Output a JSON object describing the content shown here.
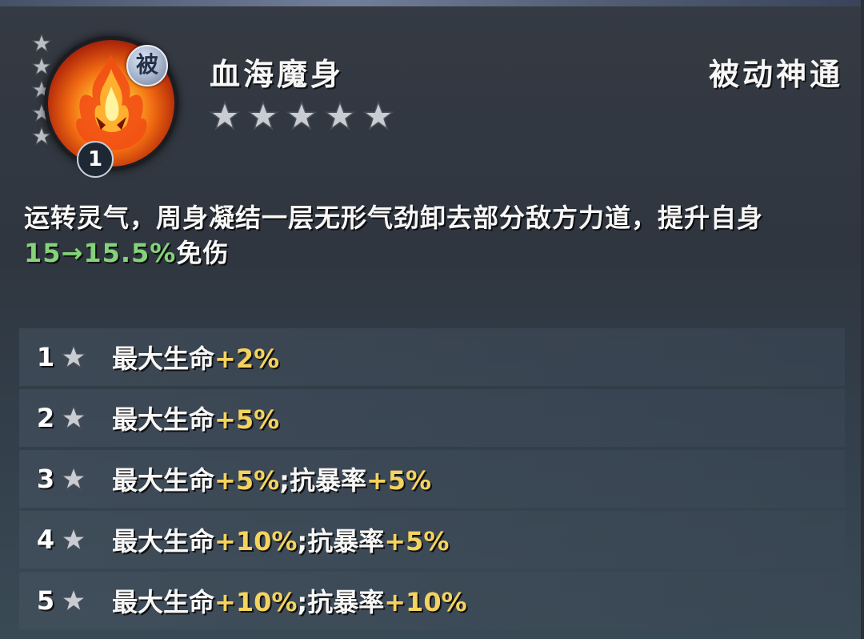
{
  "skill": {
    "name": "血海魔身",
    "type": "被动神通",
    "badge": "被",
    "level": "1",
    "rating_stars": 5,
    "description_prefix": "运转灵气，周身凝结一层无形气劲卸去部分敌方力道，提升自身",
    "description_value": "15→15.5%",
    "description_suffix": "免伤"
  },
  "levels": [
    {
      "num": "1",
      "parts": [
        {
          "text": "最大生命",
          "value": "+2%"
        }
      ]
    },
    {
      "num": "2",
      "parts": [
        {
          "text": "最大生命",
          "value": "+5%"
        }
      ]
    },
    {
      "num": "3",
      "parts": [
        {
          "text": "最大生命",
          "value": "+5%"
        },
        {
          "text": ";抗暴率",
          "value": "+5%"
        }
      ]
    },
    {
      "num": "4",
      "parts": [
        {
          "text": "最大生命",
          "value": "+10%"
        },
        {
          "text": ";抗暴率",
          "value": "+5%"
        }
      ]
    },
    {
      "num": "5",
      "parts": [
        {
          "text": "最大生命",
          "value": "+10%"
        },
        {
          "text": ";抗暴率",
          "value": "+10%"
        }
      ]
    }
  ],
  "icons": {
    "skill_icon": "blood-flame-icon",
    "star": "star-icon"
  },
  "colors": {
    "highlight_green": "#84d27a",
    "value_gold": "#f4d35e"
  }
}
